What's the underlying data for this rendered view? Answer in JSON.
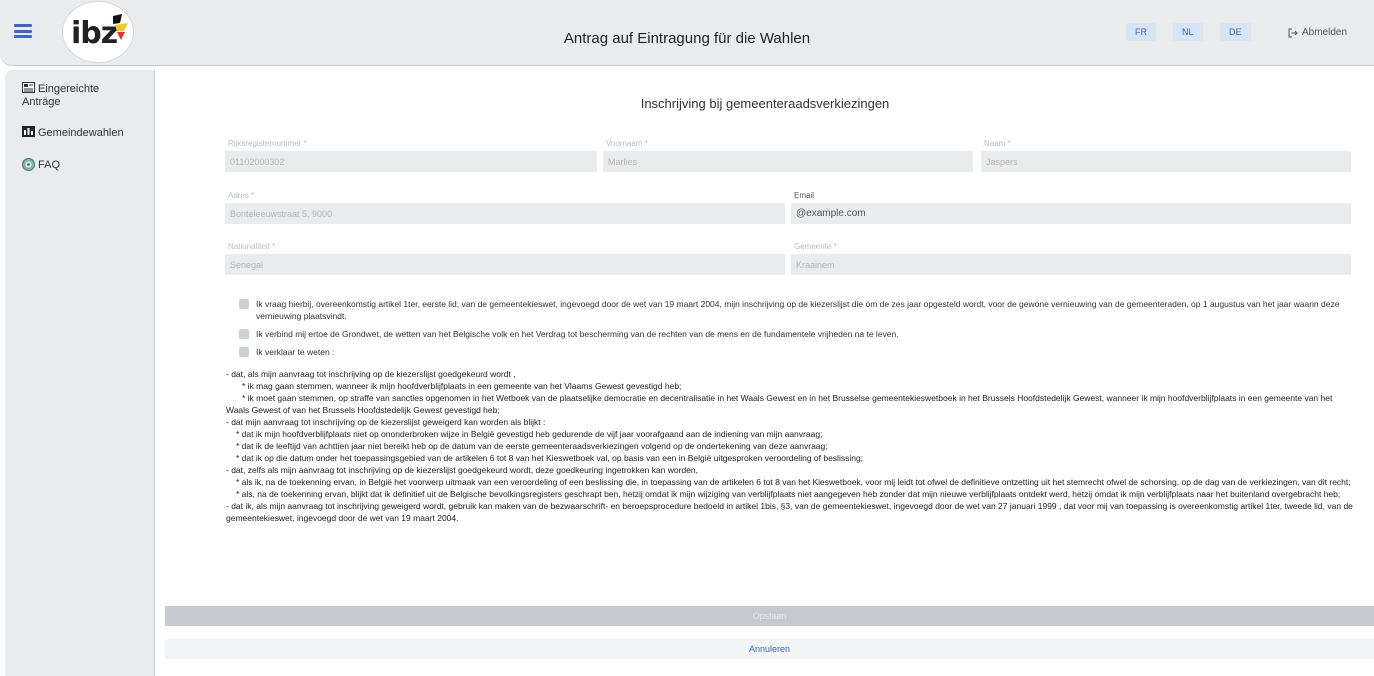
{
  "header": {
    "title": "Antrag auf Eintragung für die Wahlen",
    "logo_text": "ibz",
    "languages": [
      "FR",
      "NL",
      "DE"
    ],
    "logout_label": "Abmelden"
  },
  "sidebar": {
    "items": [
      {
        "label": "Eingereichte Anträge",
        "icon": "document-icon"
      },
      {
        "label": "Gemeindewahlen",
        "icon": "city-icon"
      },
      {
        "label": "FAQ",
        "icon": "help-icon"
      }
    ]
  },
  "form": {
    "page_title": "Inschrijving bij gemeenteraadsverkiezingen",
    "fields": {
      "rijksregisternummer": {
        "label": "Rijksregisternummer *",
        "value": "01102000302"
      },
      "voornaam": {
        "label": "Voornaam *",
        "value": "Marlies"
      },
      "naam": {
        "label": "Naam *",
        "value": "Jaspers"
      },
      "adres": {
        "label": "Adres *",
        "value": "Bonteleeuwstraat 5, 9000"
      },
      "email": {
        "label": "Email",
        "value": "@example.com"
      },
      "nationaliteit": {
        "label": "Nationaliteit *",
        "value": "Senegal"
      },
      "gemeente": {
        "label": "Gemeente *",
        "value": "Kraainem"
      }
    },
    "checkboxes": [
      "Ik vraag hierbij, overeenkomstig artikel 1ter, eerste lid, van de gemeentekieswet, ingevoegd door de wet van 19 maart 2004, mijn inschrijving op de kiezerslijst die om de zes jaar opgesteld wordt, voor de gewone vernieuwing van de gemeenteraden, op 1 augustus van het jaar waarin deze vernieuwing plaatsvindt.",
      "Ik verbind mij ertoe de Grondwet, de wetten van het Belgische volk en het Verdrag tot bescherming van de rechten van de mens en de fundamentele vrijheden na te leven.",
      "Ik verklaar te weten :"
    ],
    "declaration": [
      "- dat, als mijn aanvraag tot inschrijving op de kiezerslijst goedgekeurd wordt ,",
      "      * ik mag gaan stemmen, wanneer ik mijn hoofdverblijfplaats in een gemeente van het Vlaams Gewest gevestigd heb;",
      "      * ik moet gaan stemmen, op straffe van sancties opgenomen in het Wetboek van de plaatselijke democratie en decentralisatie in het Waals Gewest en in het Brusselse gemeentekieswetboek in het Brussels Hoofdstedelijk Gewest, wanneer ik mijn hoofdverblijfplaats in een gemeente van het Waals Gewest of van het Brussels Hoofdstedelijk Gewest gevestigd heb;",
      "- dat mijn aanvraag tot inschrijving op de kiezerslijst geweigerd kan worden als blijkt :",
      "    * dat ik mijn hoofdverblijfplaats niet op ononderbroken wijze in België gevestigd heb gedurende de vijf jaar voorafgaand aan de indiening van mijn aanvraag;",
      "    * dat ik de leeftijd van achttien jaar niet bereikt heb op de datum van de eerste gemeenteraadsverkiezingen volgend op de ondertekening van deze aanvraag;",
      "    * dat ik op die datum onder het toepassingsgebied van de artikelen 6 tot 8 van het Kieswetboek val, op basis van een in België uitgesproken veroordeling of beslissing;",
      "- dat, zelfs als mijn aanvraag tot inschrijving op de kiezerslijst goedgekeurd wordt, deze goedkeuring ingetrokken kan worden,",
      "    * als ik, na de toekenning ervan, in België het voorwerp uitmaak van een veroordeling of een beslissing die, in toepassing van de artikelen 6 tot 8 van het Kieswetboek, voor mij leidt tot ofwel de definitieve ontzetting uit het stemrecht ofwel de schorsing, op de dag van de verkiezingen, van dit recht;",
      "    * als, na de toekenning ervan, blijkt dat ik definitief uit de Belgische bevolkingsregisters geschrapt ben, hetzij omdat ik mijn wijziging van verblijfplaats niet aangegeven heb zonder dat mijn nieuwe verblijfplaats ontdekt werd, hetzij omdat ik mijn verblijfplaats naar het buitenland overgebracht heb;",
      "- dat ik, als mijn aanvraag tot inschrijving geweigerd wordt, gebruik kan maken van de bezwaarschrift- en beroepsprocedure bedoeld in artikel 1bis, §3, van de gemeentekieswet, ingevoegd door de wet van 27 januari 1999 , dat voor mij van toepassing is overeenkomstig artikel 1ter, tweede lid, van de gemeentekieswet, ingevoegd door de wet van 19 maart 2004."
    ],
    "save_label": "Opslaan",
    "cancel_label": "Annuleren"
  },
  "colors": {
    "accent": "#3a67c8",
    "panel_bg": "#e9ebed",
    "input_bg": "#e9ebed",
    "disabled_button": "#c6c9cd"
  }
}
